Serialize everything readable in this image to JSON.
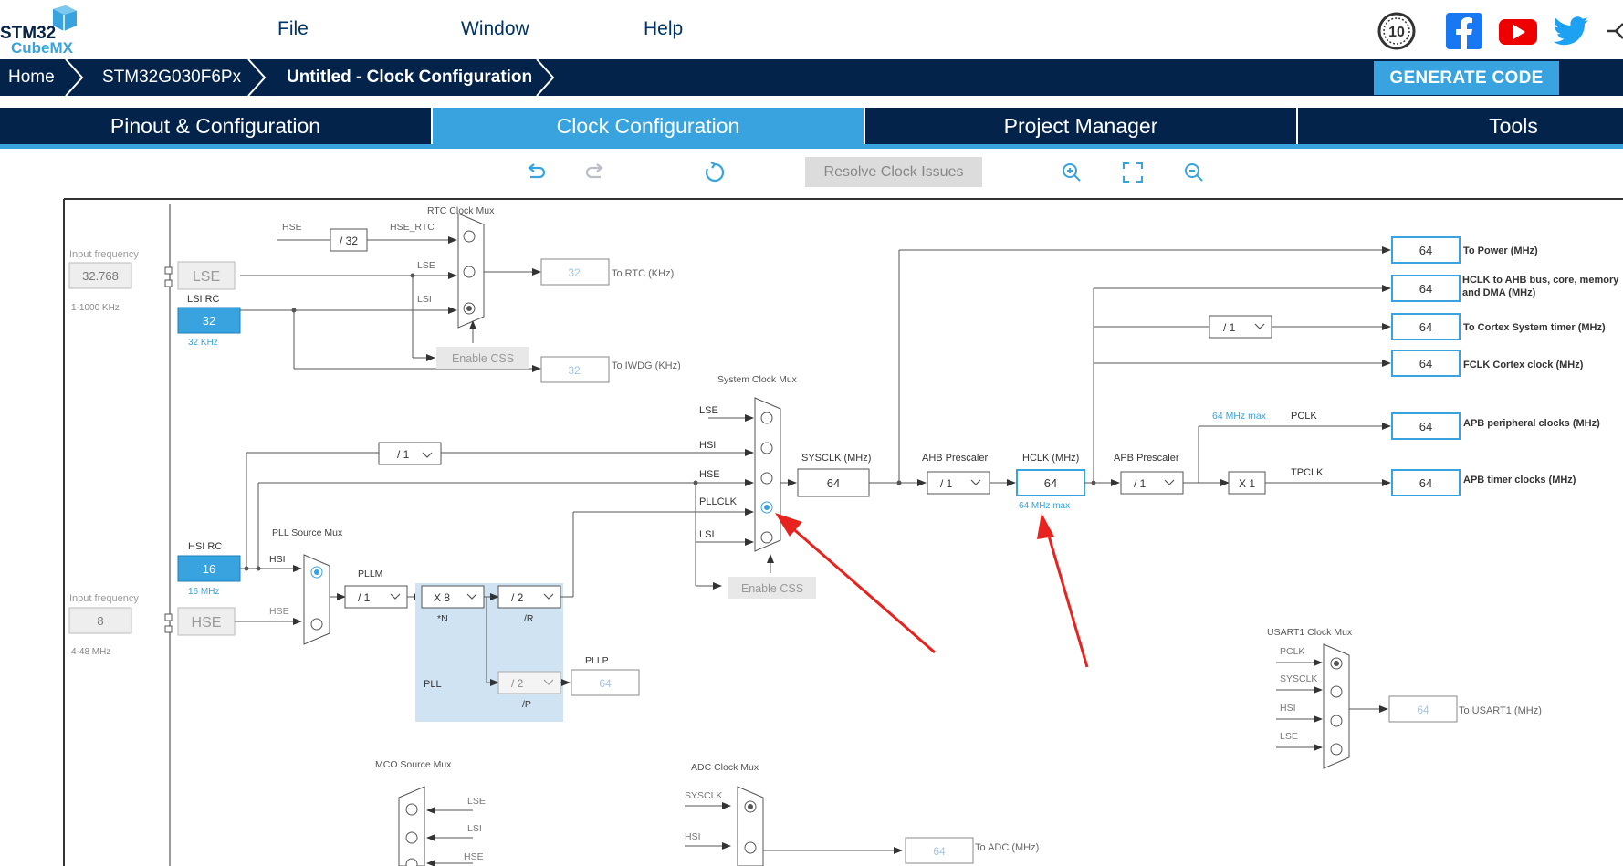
{
  "logo": {
    "line1": "STM32",
    "line2": "CubeMX"
  },
  "menu": {
    "file": "File",
    "window": "Window",
    "help": "Help"
  },
  "social": {
    "anniversary": "10",
    "facebook": "facebook-icon",
    "youtube": "youtube-icon",
    "twitter": "twitter-icon"
  },
  "breadcrumb": {
    "home": "Home",
    "chip": "STM32G030F6Px",
    "page": "Untitled - Clock Configuration"
  },
  "generate_code": "GENERATE CODE",
  "tabs": {
    "pinout": "Pinout & Configuration",
    "clock": "Clock Configuration",
    "project": "Project Manager",
    "tools": "Tools"
  },
  "toolbar": {
    "resolve": "Resolve Clock Issues"
  },
  "colors": {
    "navy": "#03234b",
    "accent": "#38a3de",
    "red": "#e8231f"
  },
  "diagram": {
    "lse_input": {
      "label": "Input frequency",
      "value": "32.768",
      "range": "1-1000 KHz",
      "name": "LSE"
    },
    "lsi": {
      "name": "LSI RC",
      "value": "32",
      "unit": "32 KHz"
    },
    "hsi": {
      "name": "HSI RC",
      "value": "16",
      "unit": "16 MHz"
    },
    "hse_input": {
      "label": "Input frequency",
      "value": "8",
      "range": "4-48 MHz",
      "name": "HSE"
    },
    "rtc_mux": {
      "title": "RTC Clock Mux",
      "hse": "HSE",
      "div32": "/ 32",
      "hse_rtc": "HSE_RTC",
      "lse": "LSE",
      "lsi": "LSI",
      "enable_css": "Enable CSS",
      "rtc_value": "32",
      "rtc_label": "To RTC (KHz)",
      "iwdg_value": "32",
      "iwdg_label": "To IWDG (KHz)"
    },
    "sys_mux": {
      "title": "System Clock Mux",
      "lse": "LSE",
      "hsi": "HSI",
      "hse": "HSE",
      "pllclk": "PLLCLK",
      "lsi": "LSI",
      "enable_css": "Enable CSS",
      "hsi_div": "/ 1"
    },
    "pll": {
      "src_title": "PLL Source Mux",
      "hsi": "HSI",
      "hse": "HSE",
      "pllm_label": "PLLM",
      "pllm": "/ 1",
      "n": "X 8",
      "n_label": "*N",
      "r": "/ 2",
      "r_label": "/R",
      "p": "/ 2",
      "p_label": "/P",
      "pllp_label": "PLLP",
      "pllp_value": "64",
      "pll_label": "PLL"
    },
    "sysclk": {
      "label": "SYSCLK (MHz)",
      "value": "64"
    },
    "ahb": {
      "label": "AHB Prescaler",
      "value": "/ 1"
    },
    "hclk": {
      "label": "HCLK (MHz)",
      "value": "64",
      "max": "64 MHz max"
    },
    "apb": {
      "label": "APB Prescaler",
      "value": "/ 1"
    },
    "cortex_div": "/ 1",
    "x1": "X 1",
    "pclk": {
      "label": "PCLK",
      "max": "64 MHz max"
    },
    "tpclk": "TPCLK",
    "outputs": [
      {
        "value": "64",
        "label": "To Power (MHz)"
      },
      {
        "value": "64",
        "label": "HCLK to AHB bus, core, memory and DMA (MHz)"
      },
      {
        "value": "64",
        "label": "To Cortex System timer (MHz)"
      },
      {
        "value": "64",
        "label": "FCLK Cortex clock (MHz)"
      },
      {
        "value": "64",
        "label": "APB peripheral clocks (MHz)"
      },
      {
        "value": "64",
        "label": "APB timer clocks (MHz)"
      }
    ],
    "usart_mux": {
      "title": "USART1 Clock Mux",
      "pclk": "PCLK",
      "sysclk": "SYSCLK",
      "hsi": "HSI",
      "lse": "LSE",
      "value": "64",
      "label": "To USART1 (MHz)"
    },
    "mco_mux": {
      "title": "MCO Source Mux",
      "lse": "LSE",
      "lsi": "LSI",
      "hse": "HSE"
    },
    "adc_mux": {
      "title": "ADC Clock Mux",
      "sysclk": "SYSCLK",
      "hsi": "HSI",
      "value": "64",
      "label": "To ADC (MHz)"
    }
  }
}
